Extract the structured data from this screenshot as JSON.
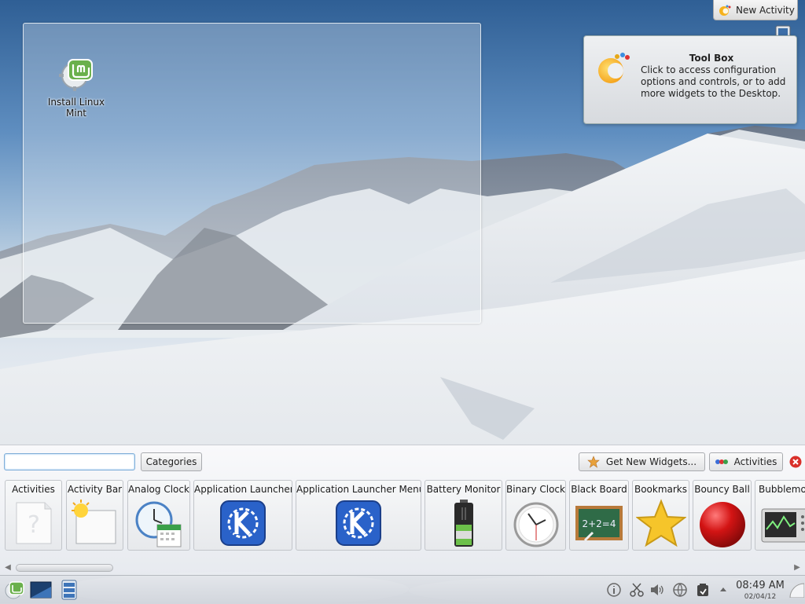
{
  "desktop": {
    "icons": [
      {
        "label": "Install Linux Mint",
        "icon": "linux-mint-installer-icon"
      }
    ]
  },
  "top_panel": {
    "new_activity_label": "New Activity",
    "toolbox_tip": {
      "title": "Tool Box",
      "body": "Click to access configuration options and controls, or to add more widgets to the Desktop."
    }
  },
  "widget_explorer": {
    "search": {
      "value": "",
      "placeholder": ""
    },
    "categories_label": "Categories",
    "get_new_widgets_label": "Get New Widgets...",
    "activities_label": "Activities",
    "widgets": [
      {
        "name": "Activities",
        "icon": "question-page-icon"
      },
      {
        "name": "Activity Bar",
        "icon": "activity-bar-icon"
      },
      {
        "name": "Analog Clock",
        "icon": "analog-clock-calendar-icon"
      },
      {
        "name": "Application Launcher",
        "icon": "kde-launcher-icon"
      },
      {
        "name": "Application Launcher Menu",
        "icon": "kde-launcher-icon"
      },
      {
        "name": "Battery Monitor",
        "icon": "battery-icon"
      },
      {
        "name": "Binary Clock",
        "icon": "clock-icon"
      },
      {
        "name": "Black Board",
        "icon": "blackboard-icon"
      },
      {
        "name": "Bookmarks",
        "icon": "star-icon"
      },
      {
        "name": "Bouncy Ball",
        "icon": "red-ball-icon"
      },
      {
        "name": "Bubblemon",
        "icon": "system-monitor-icon"
      }
    ],
    "blackboard_text": "2+2=4"
  },
  "taskbar": {
    "clock_time": "08:49 AM",
    "clock_date": "02/04/12"
  },
  "colors": {
    "kde_blue": "#2a62c9",
    "close_red": "#d9302a",
    "ball_red": "#d31414",
    "star_yellow": "#f6c52a",
    "mint_green": "#6ab04c"
  }
}
